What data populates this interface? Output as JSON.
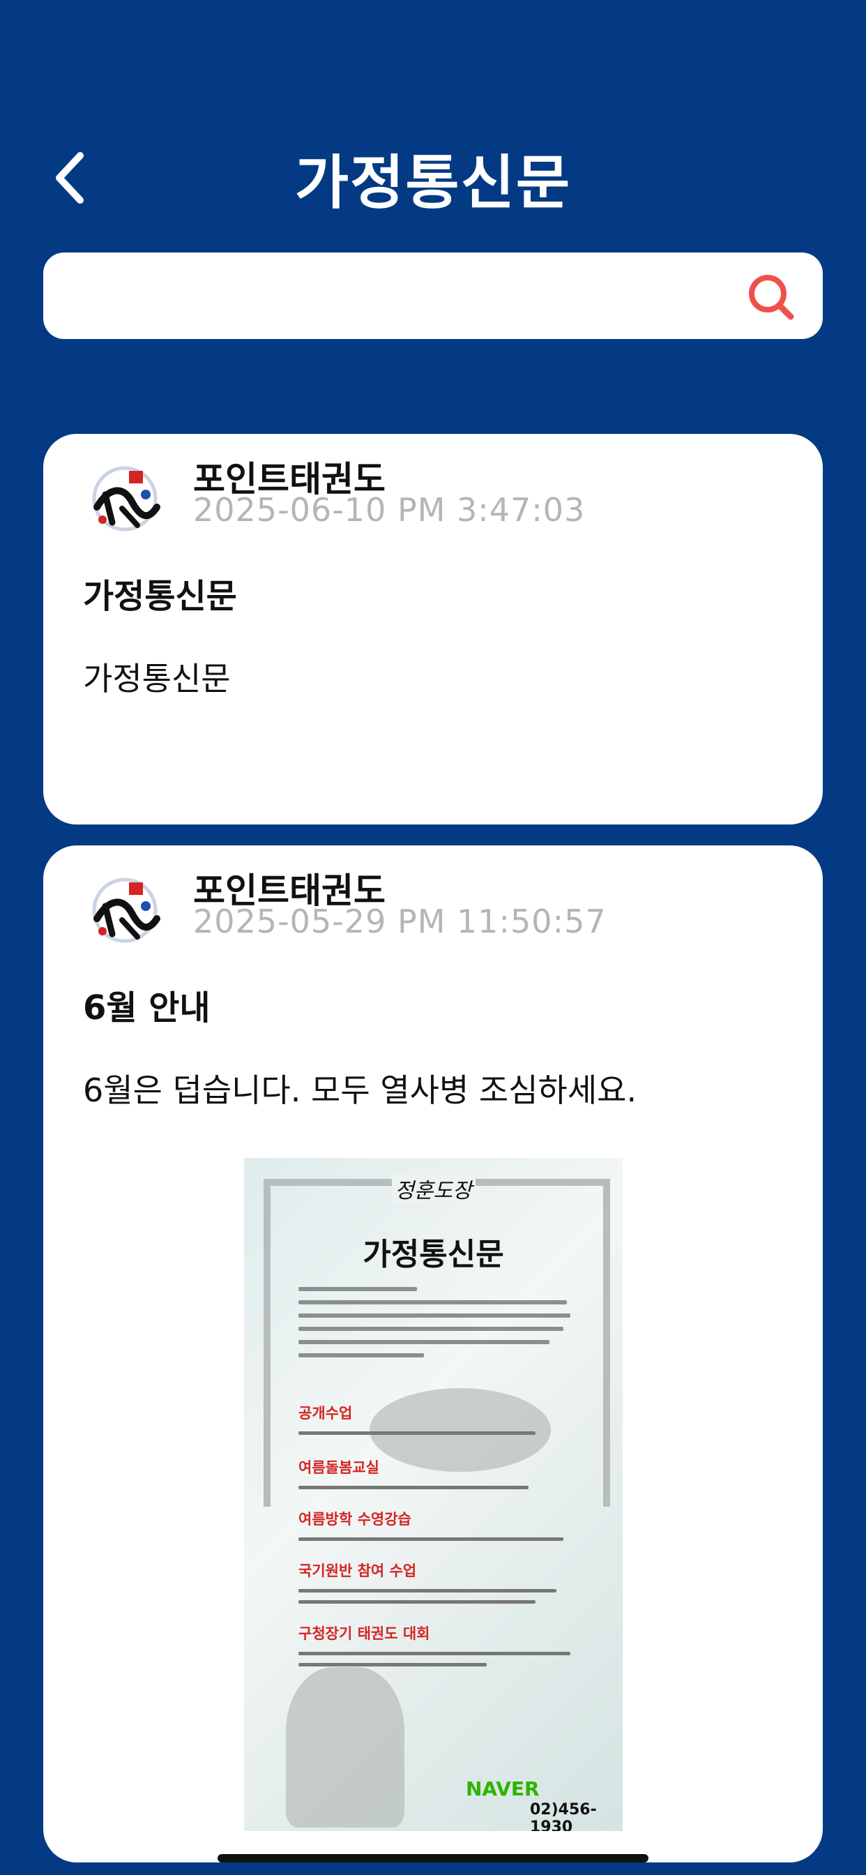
{
  "header": {
    "title": "가정통신문",
    "back_icon": "chevron-left-icon"
  },
  "search": {
    "value": "",
    "placeholder": "",
    "icon": "search-icon",
    "icon_color": "#f0504a"
  },
  "posts": [
    {
      "author": "포인트태권도",
      "date": "2025-06-10 PM 3:47:03",
      "title": "가정통신문",
      "body": "가정통신문"
    },
    {
      "author": "포인트태권도",
      "date": "2025-05-29 PM 11:50:57",
      "title": "6월 안내",
      "body": "6월은 덥습니다. 모두 열사병 조심하세요.",
      "image": {
        "title": "가정통신문",
        "signature": "정훈도장",
        "sections": [
          "공개수업",
          "여름돌봄교실",
          "여름방학 수영강습",
          "국기원반 참여 수업",
          "구청장기 태권도 대회"
        ],
        "brand": "NAVER",
        "phone": "02)456-1930"
      }
    }
  ],
  "colors": {
    "background": "#033a83",
    "card": "#ffffff",
    "date": "#b5b5b5"
  }
}
